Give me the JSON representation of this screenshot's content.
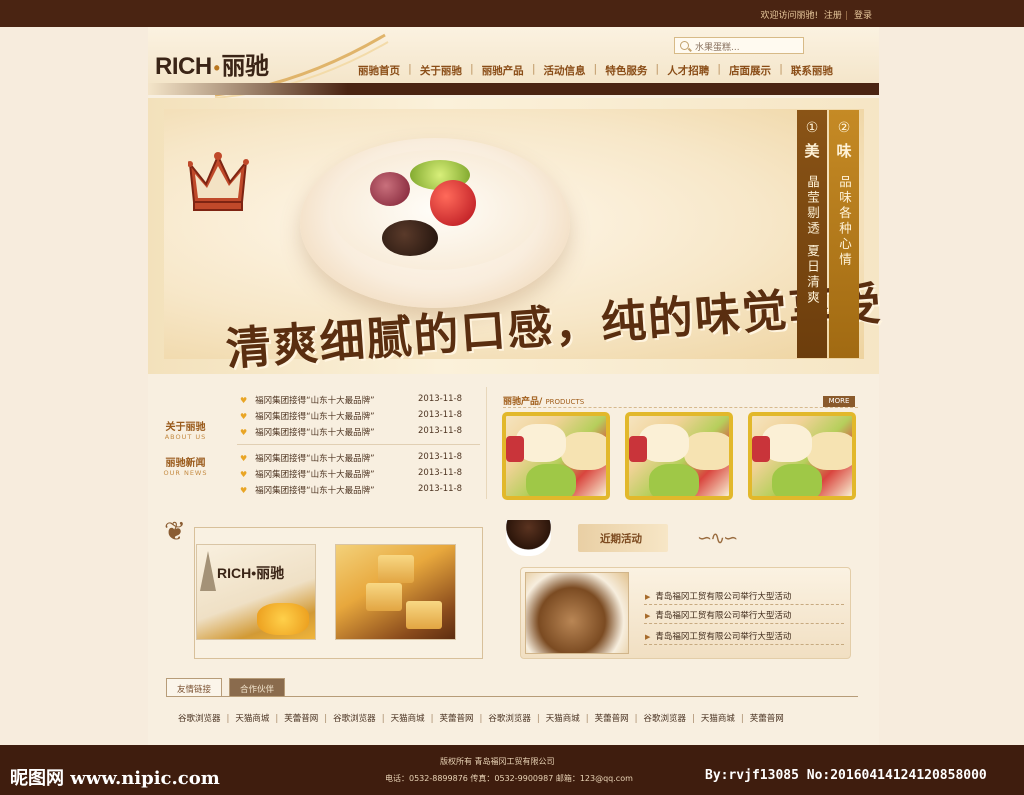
{
  "topbar": {
    "welcome": "欢迎访问丽驰!",
    "register": "注册",
    "login": "登录",
    "sep": "|"
  },
  "logo": {
    "brand": "RICH",
    "dot": "•",
    "cn": "丽驰"
  },
  "search": {
    "placeholder": "水果蛋糕..."
  },
  "nav": {
    "items": [
      "丽驰首页",
      "关于丽驰",
      "丽驰产品",
      "活动信息",
      "特色服务",
      "人才招聘",
      "店面展示",
      "联系丽驰"
    ],
    "sep": "|"
  },
  "banner": {
    "slogan": "清爽细腻的口感，纯的味觉享受",
    "tab1": {
      "num": "①",
      "title": "美",
      "text": "晶莹剔透 夏日清爽"
    },
    "tab2": {
      "num": "②",
      "title": "味",
      "text": "品味各种心情"
    }
  },
  "side": {
    "about": {
      "cn": "关于丽驰",
      "en": "ABOUT US"
    },
    "news": {
      "cn": "丽驰新闻",
      "en": "OUR NEWS"
    }
  },
  "news": [
    {
      "title": "福冈集团接得“山东十大最品牌”",
      "date": "2013-11-8"
    },
    {
      "title": "福冈集团接得“山东十大最品牌”",
      "date": "2013-11-8"
    },
    {
      "title": "福冈集团接得“山东十大最品牌”",
      "date": "2013-11-8"
    },
    {
      "title": "福冈集团接得“山东十大最品牌”",
      "date": "2013-11-8"
    },
    {
      "title": "福冈集团接得“山东十大最品牌”",
      "date": "2013-11-8"
    },
    {
      "title": "福冈集团接得“山东十大最品牌”",
      "date": "2013-11-8"
    }
  ],
  "products": {
    "title": "丽驰产品/",
    "title_en": "PRODUCTS",
    "more": "MORE"
  },
  "about_pic": {
    "brand": "RICH•丽驰"
  },
  "activity": {
    "title": "近期活动",
    "items": [
      "青岛福冈工贸有限公司举行大型活动",
      "青岛福冈工贸有限公司举行大型活动",
      "青岛福冈工贸有限公司举行大型活动"
    ]
  },
  "tabs": {
    "friend_links": "友情链接",
    "partners": "合作伙伴"
  },
  "links": [
    "谷歌浏览器",
    "天猫商城",
    "芙蕾普网",
    "谷歌浏览器",
    "天猫商城",
    "芙蕾普网",
    "谷歌浏览器",
    "天猫商城",
    "芙蕾普网",
    "谷歌浏览器",
    "天猫商城",
    "芙蕾普网"
  ],
  "footer": {
    "copyright": "版权所有    青岛福冈工贸有限公司",
    "contact": "电话：0532-8899876    传真：0532-9900987    邮箱：123@qq.com"
  },
  "watermark": {
    "left": "昵图网 www.nipic.com",
    "right": "By:rvjf13085 No:20160414124120858000"
  },
  "colors": {
    "dark_brown": "#4a2412",
    "gold": "#e2b82b",
    "accent": "#a15f1c"
  }
}
